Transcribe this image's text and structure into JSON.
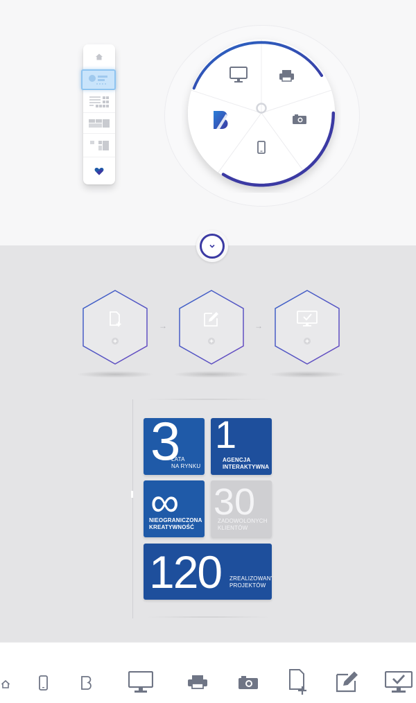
{
  "colors": {
    "accent_blue": "#1f5aa8",
    "accent_indigo": "#3b3aa3",
    "tile_grey": "#cfcfd2",
    "icon_grey": "#6f7585"
  },
  "remote_panel": {
    "items": [
      "home-icon",
      "media-layout-icon",
      "grid-layout-icon",
      "tiles-layout-icon",
      "mixed-layout-icon",
      "heart-icon"
    ],
    "selected_index": 1
  },
  "device_wheel": {
    "segments": [
      "monitor-icon",
      "printer-icon",
      "camera-icon",
      "mobile-icon",
      "brand-logo"
    ],
    "center_icon": "loading-ring-icon"
  },
  "toggle": {
    "icon": "chevron-down-icon"
  },
  "steps": [
    {
      "icon": "new-document-icon",
      "badge": "plus-icon"
    },
    {
      "icon": "edit-icon",
      "badge": "plus-icon"
    },
    {
      "icon": "monitor-check-icon",
      "badge": "plus-icon"
    }
  ],
  "stats": {
    "years": {
      "number": "3",
      "line1": "LATA",
      "line2": "NA RYNKU"
    },
    "agency": {
      "number": "1",
      "line1": "AGENCJA",
      "line2": "INTERAKTYWNA"
    },
    "creativity": {
      "symbol": "∞",
      "line1": "NIEOGRANICZONA",
      "line2": "KREATYWNOŚĆ"
    },
    "clients": {
      "number": "30",
      "line1": "ZADOWOLONYCH",
      "line2": "KLIENTÓW"
    },
    "projects": {
      "number": "120",
      "line1": "ZREALIZOWANYCH",
      "line2": "PROJEKTÓW"
    }
  },
  "bottom_bar": {
    "icons": [
      "home-icon",
      "mobile-icon",
      "brand-b-icon",
      "monitor-icon",
      "printer-icon",
      "camera-icon",
      "new-document-icon",
      "edit-icon",
      "monitor-check-icon"
    ]
  }
}
